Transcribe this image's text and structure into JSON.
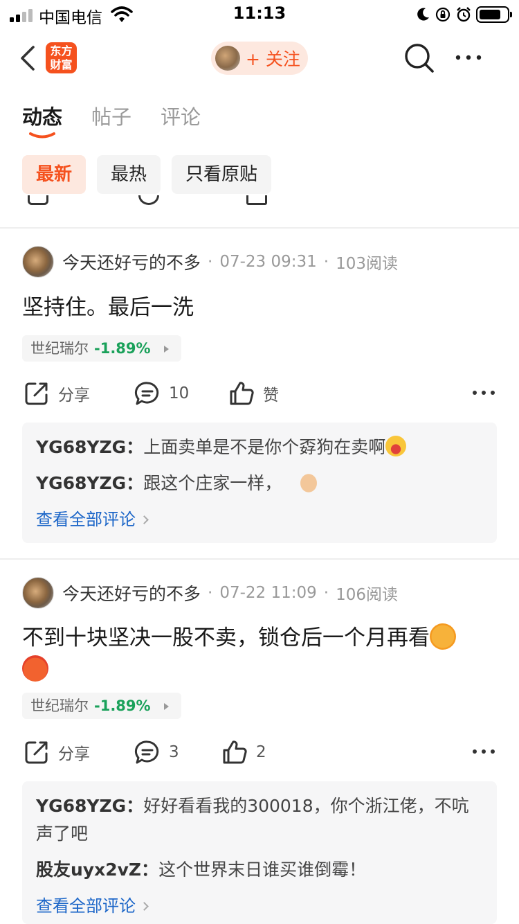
{
  "status_bar": {
    "carrier": "中国电信",
    "time": "11:13"
  },
  "nav": {
    "logo_line1": "东方",
    "logo_line2": "财富",
    "follow_label": "+ 关注"
  },
  "tabs": [
    {
      "label": "动态",
      "active": true
    },
    {
      "label": "帖子",
      "active": false
    },
    {
      "label": "评论",
      "active": false
    }
  ],
  "filters": [
    {
      "label": "最新",
      "active": true
    },
    {
      "label": "最热",
      "active": false
    },
    {
      "label": "只看原贴",
      "active": false
    }
  ],
  "accent_color": "#f5511e",
  "down_color": "#1aa15a",
  "link_color": "#1c66c8",
  "posts": [
    {
      "author": "今天还好亏的不多",
      "time": "07-23 09:31",
      "reads": "103阅读",
      "text": "坚持住。最后一洗",
      "stock": {
        "name": "世纪瑞尔",
        "change": "-1.89%"
      },
      "share_label": "分享",
      "comment_count": "10",
      "like_label": "赞",
      "comments": [
        {
          "user": "YG68YZG",
          "sep": "：",
          "text": "上面卖单是不是你个孬狗在卖啊",
          "emoji": "laugh-icon"
        },
        {
          "user": "YG68YZG",
          "sep": "：",
          "text": "跟这个庄家一样，",
          "emoji": "thumbs-up-icon"
        }
      ],
      "see_all": "查看全部评论"
    },
    {
      "author": "今天还好亏的不多",
      "time": "07-22 11:09",
      "reads": "106阅读",
      "text": "不到十块坚决一股不卖，锁仓后一个月再看",
      "stock": {
        "name": "世纪瑞尔",
        "change": "-1.89%"
      },
      "share_label": "分享",
      "comment_count": "3",
      "like_label": "2",
      "comments": [
        {
          "user": "YG68YZG",
          "sep": "：",
          "text": "好好看看我的300018，你个浙江佬，不吭声了吧"
        },
        {
          "user": "股友uyx2vZ",
          "sep": "：",
          "text": "这个世界末日谁买谁倒霉！"
        }
      ],
      "see_all": "查看全部评论"
    }
  ]
}
